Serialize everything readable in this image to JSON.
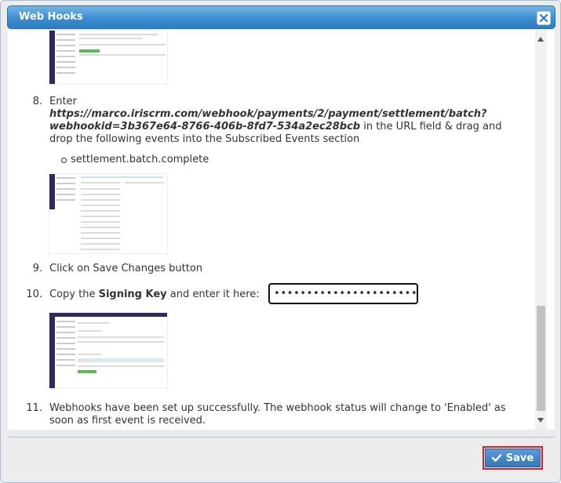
{
  "dialog": {
    "title": "Web Hooks",
    "save_label": "Save"
  },
  "steps": {
    "s8": {
      "num": "8.",
      "label": "Enter",
      "url_line1": "https://marco.iriscrm.com/webhook/payments/2/payment/settlement/batch?",
      "url_line2": "webhookid=3b367e64-8766-406b-8fd7-534a2ec28bcb",
      "tail1": " in the URL field & drag and",
      "tail2": "drop the following events into the Subscribed Events section",
      "bullet": "settlement.batch.complete"
    },
    "s9": {
      "num": "9.",
      "text": "Click on Save Changes button"
    },
    "s10": {
      "num": "10.",
      "prefix": "Copy the ",
      "bold": "Signing Key",
      "suffix": " and enter it here:",
      "key_value": "••••••••••••••••••••••••"
    },
    "s11": {
      "num": "11.",
      "line1": "Webhooks have been set up successfully. The webhook status will change to 'Enabled' as",
      "line2": "soon as first event is received."
    }
  }
}
